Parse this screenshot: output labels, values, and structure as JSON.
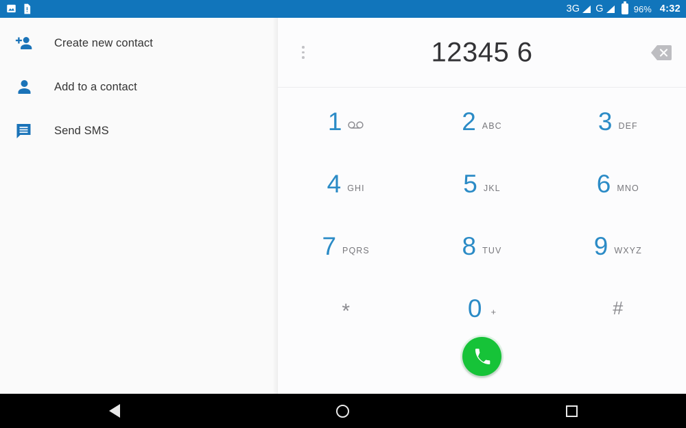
{
  "status_bar": {
    "background": "#1175bb",
    "notifications": [
      {
        "name": "image-notification-icon",
        "icon": "image-icon"
      },
      {
        "name": "document-alert-notification-icon",
        "icon": "document-alert-icon"
      }
    ],
    "network_primary": "3G",
    "network_secondary": "G",
    "battery_percent": "96%",
    "time": "4:32"
  },
  "sidebar": {
    "items": [
      {
        "label": "Create new contact",
        "icon": "person-add-icon"
      },
      {
        "label": "Add to a contact",
        "icon": "person-icon"
      },
      {
        "label": "Send SMS",
        "icon": "message-icon"
      }
    ],
    "icon_color": "#1a73b8"
  },
  "dialer": {
    "number": "12345 6",
    "overflow_menu_label": "More options",
    "delete_label": "Delete",
    "accent_color": "#2b8bc6",
    "call_button_color": "#16c338",
    "keys": [
      [
        {
          "digit": "1",
          "sub": "",
          "icon": "voicemail-icon",
          "name": "key-1"
        },
        {
          "digit": "2",
          "sub": "ABC",
          "icon": "",
          "name": "key-2"
        },
        {
          "digit": "3",
          "sub": "DEF",
          "icon": "",
          "name": "key-3"
        }
      ],
      [
        {
          "digit": "4",
          "sub": "GHI",
          "icon": "",
          "name": "key-4"
        },
        {
          "digit": "5",
          "sub": "JKL",
          "icon": "",
          "name": "key-5"
        },
        {
          "digit": "6",
          "sub": "MNO",
          "icon": "",
          "name": "key-6"
        }
      ],
      [
        {
          "digit": "7",
          "sub": "PQRS",
          "icon": "",
          "name": "key-7"
        },
        {
          "digit": "8",
          "sub": "TUV",
          "icon": "",
          "name": "key-8"
        },
        {
          "digit": "9",
          "sub": "WXYZ",
          "icon": "",
          "name": "key-9"
        }
      ],
      [
        {
          "digit": "*",
          "sub": "",
          "icon": "",
          "name": "key-star"
        },
        {
          "digit": "0",
          "sub": "+",
          "icon": "",
          "name": "key-0"
        },
        {
          "digit": "#",
          "sub": "",
          "icon": "",
          "name": "key-hash"
        }
      ]
    ],
    "call_label": "Call"
  },
  "nav_bar": {
    "back": "Back",
    "home": "Home",
    "recents": "Recent apps"
  }
}
